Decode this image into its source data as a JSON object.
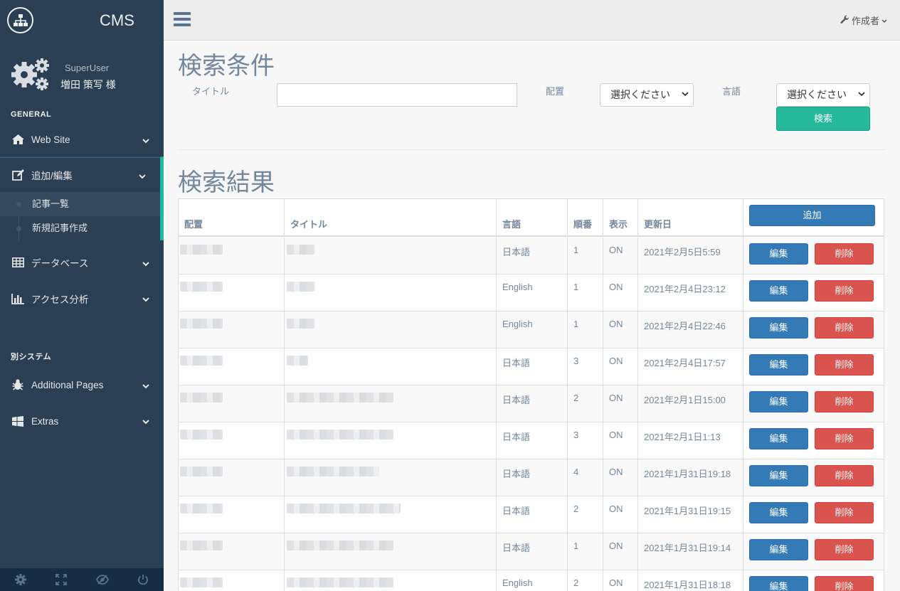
{
  "app": {
    "title": "CMS"
  },
  "profile": {
    "role": "SuperUser",
    "name": "増田 策写 様"
  },
  "sidebar": {
    "section_general": "GENERAL",
    "section_other": "別システム",
    "items": [
      {
        "label": "Web Site",
        "icon": "home-icon"
      },
      {
        "label": "追加/編集",
        "icon": "edit-icon"
      },
      {
        "label": "データベース",
        "icon": "table-icon"
      },
      {
        "label": "アクセス分析",
        "icon": "bar-chart-icon"
      },
      {
        "label": "Additional Pages",
        "icon": "bug-icon"
      },
      {
        "label": "Extras",
        "icon": "windows-icon"
      }
    ],
    "submenu": [
      {
        "label": "記事一覧"
      },
      {
        "label": "新規記事作成"
      }
    ]
  },
  "topnav": {
    "user_label": "作成者"
  },
  "search": {
    "heading": "検索条件",
    "title_label": "タイトル",
    "placement_label": "配置",
    "placement_value": "選択ください",
    "language_label": "言語",
    "language_value": "選択ください",
    "search_button": "検索"
  },
  "results": {
    "heading": "検索結果",
    "columns": [
      "配置",
      "タイトル",
      "言語",
      "順番",
      "表示",
      "更新日"
    ],
    "add_button": "追加",
    "edit_button": "編集",
    "delete_button": "削除",
    "rows": [
      {
        "language": "日本語",
        "order": "1",
        "display": "ON",
        "updated": "2021年2月5日5:59"
      },
      {
        "language": "English",
        "order": "1",
        "display": "ON",
        "updated": "2021年2月4日23:12"
      },
      {
        "language": "English",
        "order": "1",
        "display": "ON",
        "updated": "2021年2月4日22:46"
      },
      {
        "language": "日本語",
        "order": "3",
        "display": "ON",
        "updated": "2021年2月4日17:57"
      },
      {
        "language": "日本語",
        "order": "2",
        "display": "ON",
        "updated": "2021年2月1日15:00"
      },
      {
        "language": "日本語",
        "order": "3",
        "display": "ON",
        "updated": "2021年2月1日1:13"
      },
      {
        "language": "日本語",
        "order": "4",
        "display": "ON",
        "updated": "2021年1月31日19:18"
      },
      {
        "language": "日本語",
        "order": "2",
        "display": "ON",
        "updated": "2021年1月31日19:15"
      },
      {
        "language": "日本語",
        "order": "1",
        "display": "ON",
        "updated": "2021年1月31日19:14"
      },
      {
        "language": "English",
        "order": "2",
        "display": "ON",
        "updated": "2021年1月31日18:18"
      }
    ]
  },
  "colors": {
    "sidebar": "#2A3F54",
    "accent": "#1ABB9C",
    "primary": "#337AB7",
    "danger": "#D9534F",
    "success": "#26B99A"
  }
}
